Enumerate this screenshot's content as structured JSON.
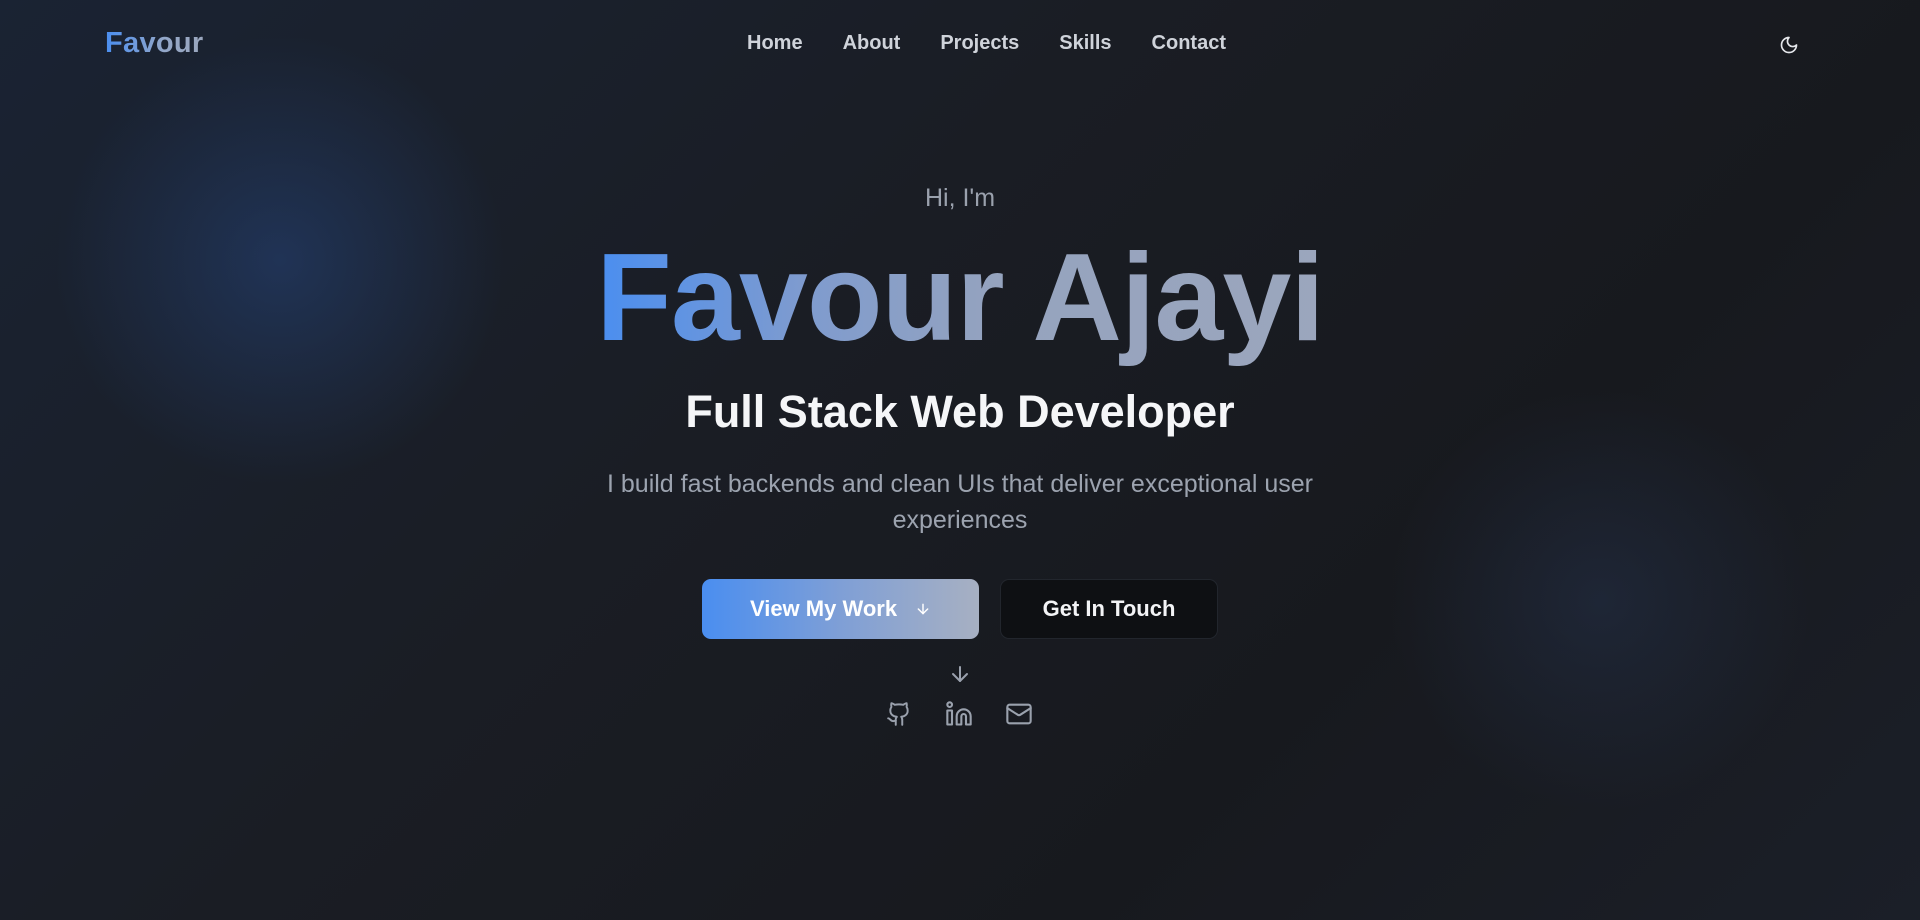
{
  "nav": {
    "logo": "Favour",
    "links": [
      "Home",
      "About",
      "Projects",
      "Skills",
      "Contact"
    ],
    "theme_toggle_icon": "moon-icon"
  },
  "hero": {
    "greeting": "Hi, I'm",
    "name": "Favour Ajayi",
    "role": "Full Stack Web Developer",
    "description": "I build fast backends and clean UIs that deliver exceptional user experiences",
    "primary_button": "View My Work",
    "primary_button_icon": "arrow-down-icon",
    "secondary_button": "Get In Touch",
    "scroll_icon": "arrow-down-icon",
    "socials": [
      "github-icon",
      "linkedin-icon",
      "mail-icon"
    ]
  },
  "colors": {
    "accent_blue": "#4a8ef0",
    "background": "#17191e",
    "text_muted": "#9ca3af"
  }
}
